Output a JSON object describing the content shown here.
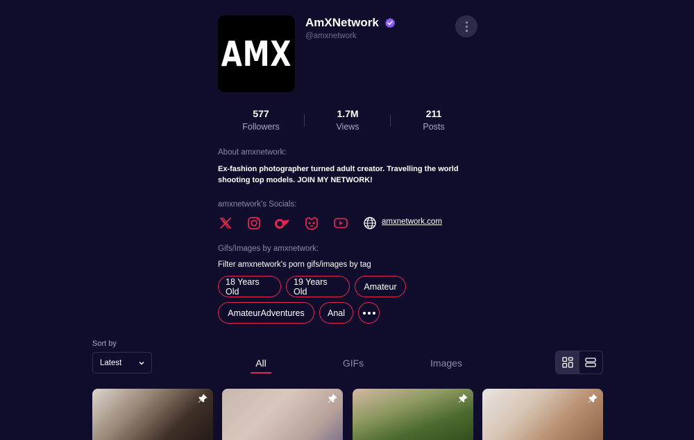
{
  "profile": {
    "avatar_text": "AMX",
    "name": "AmXNetwork",
    "handle": "@amxnetwork",
    "verified": true
  },
  "stats": [
    {
      "value": "577",
      "label": "Followers"
    },
    {
      "value": "1.7M",
      "label": "Views"
    },
    {
      "value": "211",
      "label": "Posts"
    }
  ],
  "about": {
    "heading": "About amxnetwork:",
    "text": "Ex-fashion photographer turned adult creator. Travelling the world shooting top models. JOIN MY NETWORK!"
  },
  "socials": {
    "heading": "amxnetwork's Socials:",
    "icons": [
      "x-icon",
      "instagram-icon",
      "onlyfans-icon",
      "fansly-icon",
      "youtube-icon",
      "globe-icon"
    ],
    "website": "amxnetwork.com"
  },
  "tags": {
    "heading": "Gifs/Images by amxnetwork:",
    "subheading": "Filter amxnetwork's porn gifs/images by tag",
    "row1": [
      "18 Years Old",
      "19 Years Old",
      "Amateur"
    ],
    "row2": [
      "AmateurAdventures",
      "Anal"
    ]
  },
  "sort": {
    "label": "Sort by",
    "value": "Latest"
  },
  "tabs": [
    {
      "label": "All",
      "active": true
    },
    {
      "label": "GIFs",
      "active": false
    },
    {
      "label": "Images",
      "active": false
    }
  ],
  "colors": {
    "background": "#0f0d2b",
    "accent": "#e0264f",
    "verified": "#8b5cf6"
  }
}
